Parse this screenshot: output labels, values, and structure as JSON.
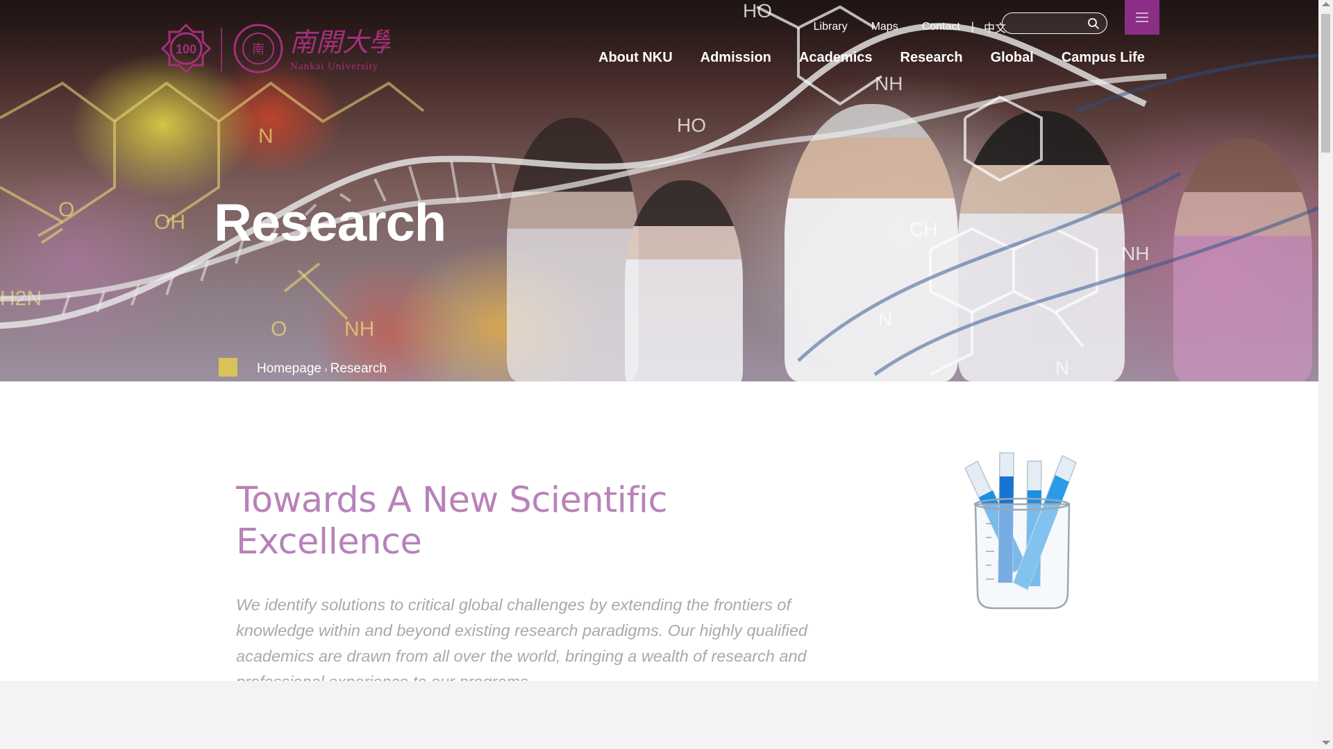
{
  "header": {
    "logo": {
      "badge_text": "100",
      "seal_text": "NANKAI UNIVERSITY",
      "chinese_name": "南開大學",
      "english_name": "Nankai University"
    },
    "top_links": [
      {
        "label": "Library"
      },
      {
        "label": "Maps"
      },
      {
        "label": "Contact"
      }
    ],
    "separator": "|",
    "language_label": "中文",
    "search": {
      "placeholder": "",
      "value": ""
    },
    "menu_icon": "hamburger-icon",
    "nav": [
      {
        "label": "About NKU"
      },
      {
        "label": "Admission"
      },
      {
        "label": "Academics"
      },
      {
        "label": "Research"
      },
      {
        "label": "Global"
      },
      {
        "label": "Campus Life"
      }
    ]
  },
  "hero": {
    "title": "Research",
    "breadcrumb": {
      "home": "Homepage",
      "separator": "›",
      "current": "Research"
    }
  },
  "content": {
    "title": "Towards A New Scientific Excellence",
    "body": "We identify solutions to critical global challenges by extending the frontiers of knowledge within and beyond existing research paradigms. Our highly qualified academics are drawn from all over the world, bringing a wealth of research and professional experience to our programs."
  },
  "colors": {
    "brand_purple": "#8b2f86",
    "title_pink": "#b882b9",
    "breadcrumb_gold": "#d9c25a",
    "body_gray": "#a9a9a9"
  }
}
